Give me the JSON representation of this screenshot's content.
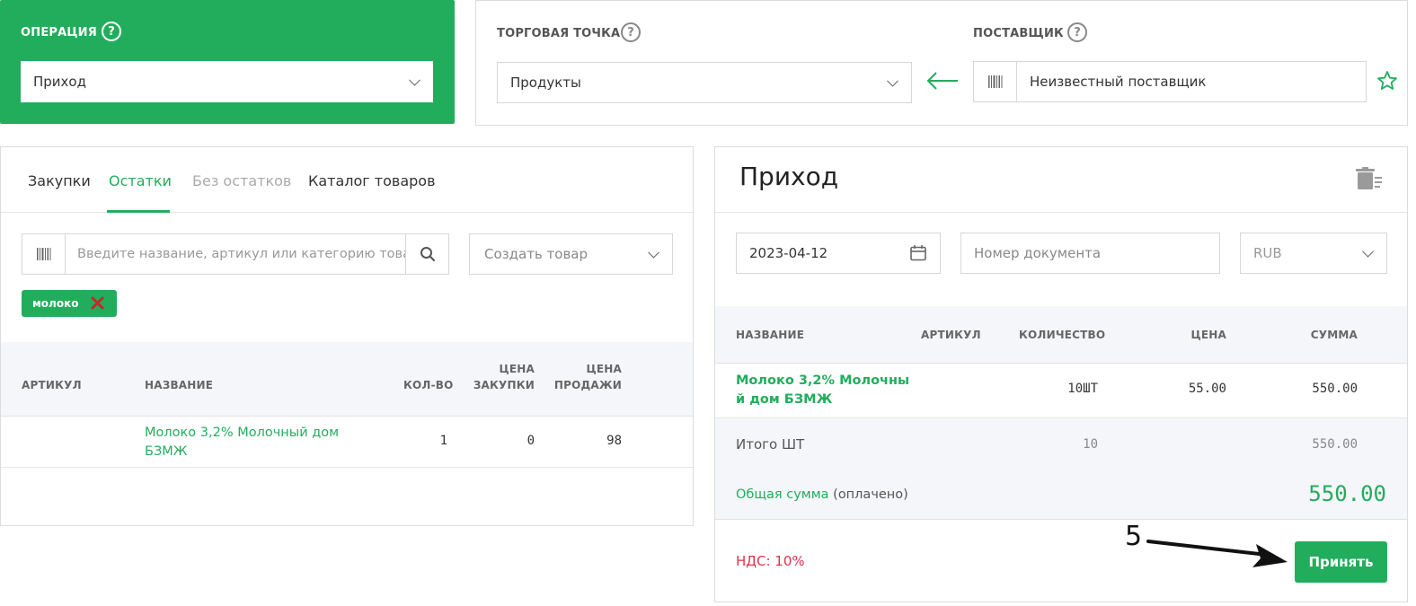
{
  "operation": {
    "label": "ОПЕРАЦИЯ",
    "help": "?",
    "selected": "Приход"
  },
  "shop": {
    "label": "ТОРГОВАЯ ТОЧКА",
    "help": "?",
    "selected": "Продукты"
  },
  "supplier": {
    "label": "ПОСТАВЩИК",
    "help": "?",
    "value": "Неизвестный поставщик"
  },
  "left": {
    "tabs": [
      "Закупки",
      "Остатки",
      "Без остатков",
      "Каталог товаров"
    ],
    "active_tab": "Остатки",
    "search_placeholder": "Введите название, артикул или категорию товара",
    "create_product": "Создать товар",
    "filter_chip": "молоко",
    "table": {
      "headers": {
        "article": "АРТИКУЛ",
        "name": "НАЗВАНИЕ",
        "qty": "КОЛ-ВО",
        "buy_price_1": "ЦЕНА",
        "buy_price_2": "ЗАКУПКИ",
        "sell_price_1": "ЦЕНА",
        "sell_price_2": "ПРОДАЖИ"
      },
      "rows": [
        {
          "article": "",
          "name_1": "Молоко 3,2% Молочный дом",
          "name_2": "БЗМЖ",
          "qty": "1",
          "buy_price": "0",
          "sell_price": "98"
        }
      ]
    }
  },
  "right": {
    "title": "Приход",
    "date": "2023-04-12",
    "doc_placeholder": "Номер документа",
    "currency": "RUB",
    "table": {
      "headers": {
        "name": "НАЗВАНИЕ",
        "article": "АРТИКУЛ",
        "qty": "КОЛИЧЕСТВО",
        "price": "ЦЕНА",
        "sum": "СУММА"
      },
      "rows": [
        {
          "name_1": "Молоко 3,2% Молочны",
          "name_2": "й дом БЗМЖ",
          "article": "",
          "qty": "10ШТ",
          "price": "55.00",
          "sum": "550.00"
        }
      ]
    },
    "total_label": "Итого ШТ",
    "total_qty": "10",
    "total_sum": "550.00",
    "grand_label": "Общая сумма",
    "grand_note": "(оплачено)",
    "grand_sum": "550.00",
    "vat": "НДС: 10%",
    "accept": "Принять"
  },
  "annotation": {
    "number": "5"
  },
  "colors": {
    "accent": "#22ad5c",
    "danger": "#e0334d",
    "header_bg": "#f4f6f9"
  }
}
